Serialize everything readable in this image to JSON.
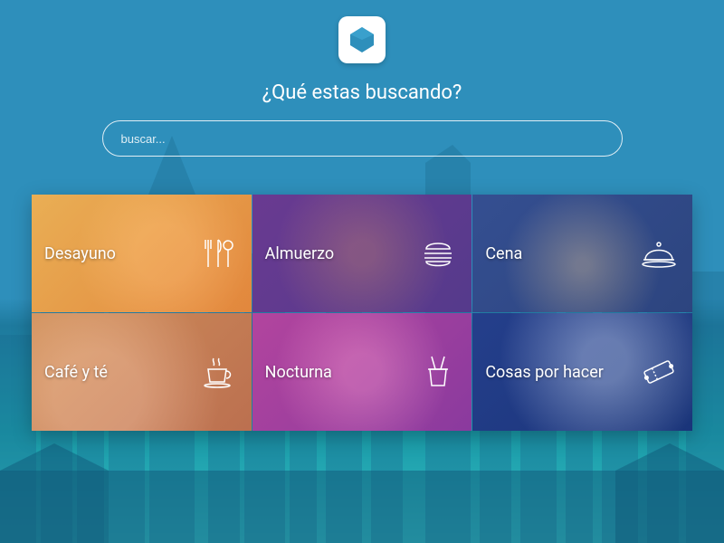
{
  "logo": {
    "glyph": "G"
  },
  "heading": "¿Qué estas buscando?",
  "search": {
    "placeholder": "buscar..."
  },
  "categories": [
    {
      "label": "Desayuno",
      "icon": "utensils"
    },
    {
      "label": "Almuerzo",
      "icon": "burger"
    },
    {
      "label": "Cena",
      "icon": "cloche"
    },
    {
      "label": "Café y té",
      "icon": "coffee-cup"
    },
    {
      "label": "Nocturna",
      "icon": "ice-bucket"
    },
    {
      "label": "Cosas por hacer",
      "icon": "ticket"
    }
  ]
}
